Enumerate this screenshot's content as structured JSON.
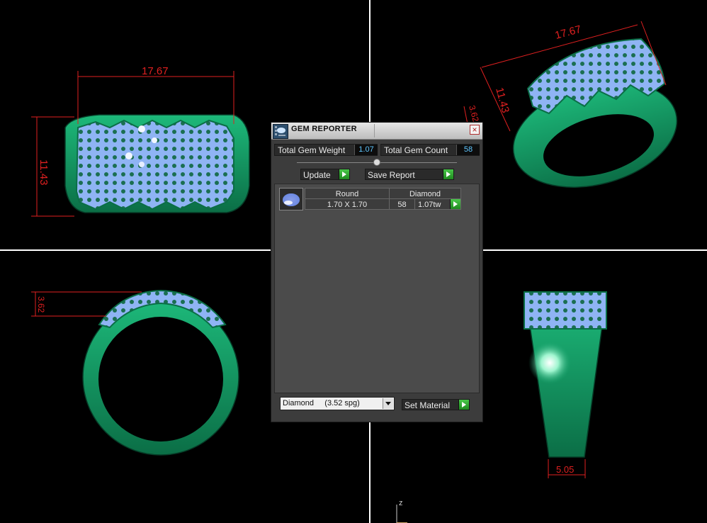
{
  "viewport": {
    "dimensions": [
      "17.67",
      "11.43",
      "17.67",
      "11.43",
      "3.62",
      "3.62",
      "5.05"
    ],
    "axis_label": "z",
    "colors": {
      "metal": "#0f9e62",
      "gem": "#8fb8ff",
      "dimension": "#e02020",
      "background": "#000000"
    }
  },
  "panel": {
    "title": "GEM REPORTER",
    "close_glyph": "×",
    "total_weight_label": "Total Gem Weight",
    "total_weight_value": "1.07",
    "total_count_label": "Total Gem Count",
    "total_count_value": "58",
    "update_label": "Update",
    "save_report_label": "Save Report",
    "table": {
      "headers": [
        "Round",
        "Diamond"
      ],
      "row": {
        "size": "1.70 X 1.70",
        "count": "58",
        "weight": "1.07tw"
      }
    },
    "material_select": "Diamond     (3.52 spg)",
    "set_material_label": "Set Material"
  }
}
